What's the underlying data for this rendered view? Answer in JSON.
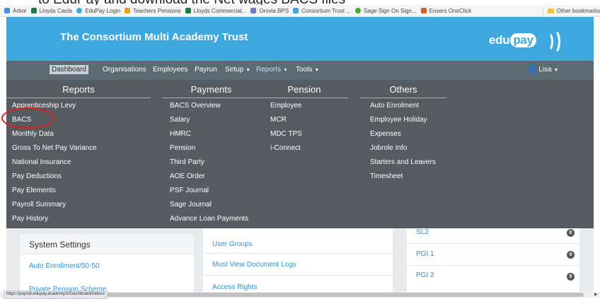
{
  "caption": "to EduPay and download the Net wages BACS files",
  "bookmarks": [
    {
      "label": "Arbor",
      "color": "#4a90d9"
    },
    {
      "label": "Lloyds Cards",
      "color": "#1b7f3b"
    },
    {
      "label": "EduPay Login",
      "color": "#3ea7dd"
    },
    {
      "label": "Teachers Pensions",
      "color": "#e6a21c"
    },
    {
      "label": "Lloyds Commercial...",
      "color": "#1b7f3b"
    },
    {
      "label": "Orovia BPS",
      "color": "#6c7bd1"
    },
    {
      "label": "Consortium Trust ...",
      "color": "#3ea7dd"
    },
    {
      "label": "Sage Sign On  Sign...",
      "color": "#3fae29"
    },
    {
      "label": "Ensers OneClick",
      "color": "#e25b1e"
    }
  ],
  "other_bookmarks": "Other bookmarks",
  "header": {
    "title": "The Consortium Multi Academy Trust",
    "logo_prefix": "edu",
    "logo_highlight": "pay",
    "bg_color": "#3ea7dd"
  },
  "nav": {
    "dashboard": "Dashboard",
    "organisations": "Organisations",
    "employees": "Employees",
    "payrun": "Payrun",
    "setup": "Setup",
    "reports": "Reports",
    "tools": "Tools",
    "user": "Lisa"
  },
  "menu": {
    "reports": {
      "heading": "Reports",
      "items": [
        "Apprenticeship Levy",
        "BACS",
        "Monthly Data",
        "Gross To Net Pay Variance",
        "National Insurance",
        "Pay Deductions",
        "Pay Elements",
        "Payroll Summary",
        "Pay History"
      ]
    },
    "payments": {
      "heading": "Payments",
      "items": [
        "BACS Overview",
        "Salary",
        "HMRC",
        "Pension",
        "Third Party",
        "AOE Order",
        "PSF Journal",
        "Sage Journal",
        "Advance Loan Payments"
      ]
    },
    "pension": {
      "heading": "Pension",
      "items": [
        "Employee",
        "MCR",
        "MDC TPS",
        "i-Connect"
      ]
    },
    "others": {
      "heading": "Others",
      "items": [
        "Auto Enrolment",
        "Employee Holiday",
        "Expenses",
        "Jobrole Info",
        "Starters and Leavers",
        "Timesheet"
      ]
    }
  },
  "settings": {
    "title": "System Settings",
    "links": [
      "Auto Enrollment/50-50",
      "Private Pension Scheme"
    ]
  },
  "middle_links": [
    "User Groups",
    "Must View Document Logs",
    "Access Rights"
  ],
  "right_links": [
    {
      "label": "SL2",
      "count": "0"
    },
    {
      "label": "PGI 1",
      "count": "0"
    },
    {
      "label": "PGI 2",
      "count": "0"
    }
  ],
  "status_url": "https://payroll.edupay.academy/X/Dashboard/Index#"
}
